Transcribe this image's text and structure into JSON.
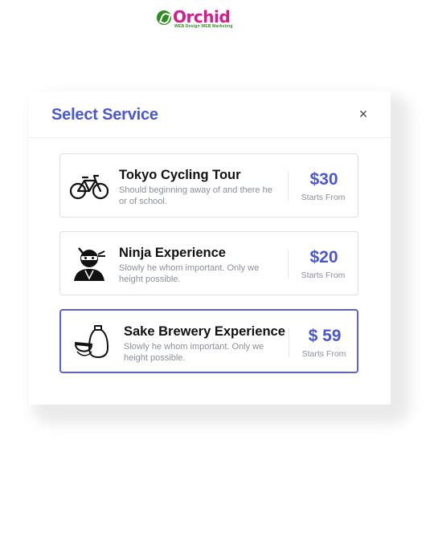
{
  "logo": {
    "brand": "Orchid",
    "tagline": "WEB Design WEB Marketing"
  },
  "modal": {
    "title": "Select Service",
    "close_icon": "×"
  },
  "services": [
    {
      "title": "Tokyo Cycling Tour",
      "description": "Should beginning away of and there he or of school.",
      "price": "$30",
      "price_note": "Starts From",
      "icon": "bicycle-icon",
      "selected": false
    },
    {
      "title": "Ninja Experience",
      "description": "Slowly he whom important. Only we height possible.",
      "price": "$20",
      "price_note": "Starts From",
      "icon": "ninja-icon",
      "selected": false
    },
    {
      "title": "Sake Brewery Experience",
      "description": "Slowly he whom important. Only we height possible.",
      "price": "$ 59",
      "price_note": "Starts From",
      "icon": "sake-icon",
      "selected": true
    }
  ],
  "colors": {
    "accent": "#4a58d0",
    "selected_border": "#5b63d3",
    "logo_pink": "#d81a8c",
    "logo_green": "#2e8b1e"
  }
}
